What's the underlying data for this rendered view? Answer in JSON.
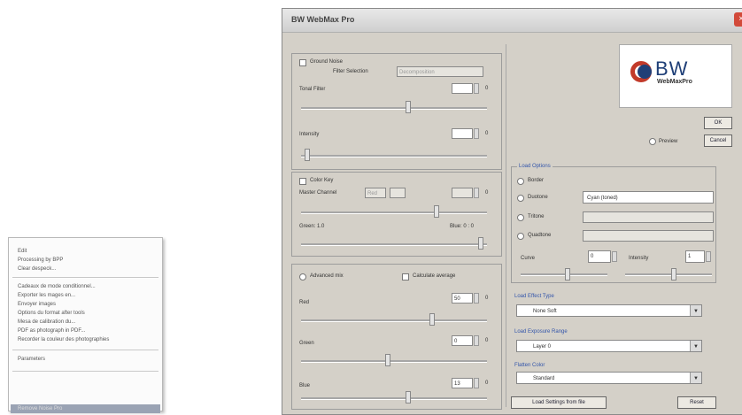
{
  "context_menu": {
    "group1": [
      "Edit",
      "Processing by BPP",
      "Clear despeck..."
    ],
    "group2": [
      "Cadeaux de mode conditionnel...",
      "Exporter les mages en...",
      "Envoyer images",
      "Options du format after tools",
      "Mesa de calibration du...",
      "PDF as photograph in PDF...",
      "Recorder la couleur des photographies"
    ],
    "group3": [
      "Parameters"
    ],
    "selected": "Remove Noise Pro"
  },
  "dialog": {
    "title": "BW WebMax Pro",
    "close": "×",
    "left": {
      "ground_noise": "Ground Noise",
      "filter_selection": "Filter Selection",
      "filter_selection_value": "Decomposition",
      "tonal_filter": "Tonal Filter",
      "tonal_filter_value": "",
      "intensity": "Intensity",
      "intensity_value": "",
      "value_unit": "0",
      "color_key": "Color Key",
      "master_channel": "Master Channel",
      "master_channel_value": "Red",
      "master_channel_value2": "",
      "green_label": "Green: 1.0",
      "blue_label": "Blue: 0 : 0",
      "advanced_mix": "Advanced mix",
      "enable_average": "Calculate average",
      "red": "Red",
      "red_value": "50",
      "green": "Green",
      "green_value": "0",
      "blue": "Blue",
      "blue_value": "13"
    },
    "right": {
      "brand_name": "BW",
      "brand_sub": "WebMaxPro",
      "ok": "OK",
      "cancel": "Cancel",
      "preview": "Preview",
      "special_options": "Load Options",
      "opt_border": "Border",
      "opt_duotone": "Duotone",
      "opt_duotone_value": "Cyan (toned)",
      "opt_tritone": "Tritone",
      "opt_quadtone": "Quadtone",
      "curve_label": "Curve",
      "curve_value": "0",
      "intensity_label": "Intensity",
      "intensity_value": "1",
      "print_size": "Load Effect Type",
      "print_size_value": "None Soft",
      "load_film": "Load Exposure Range",
      "load_film_value": "Layer 0",
      "flip_range": "Flatten Color",
      "flip_range_value": "Standard",
      "save_settings": "Load Settings from file",
      "reset": "Reset"
    }
  }
}
